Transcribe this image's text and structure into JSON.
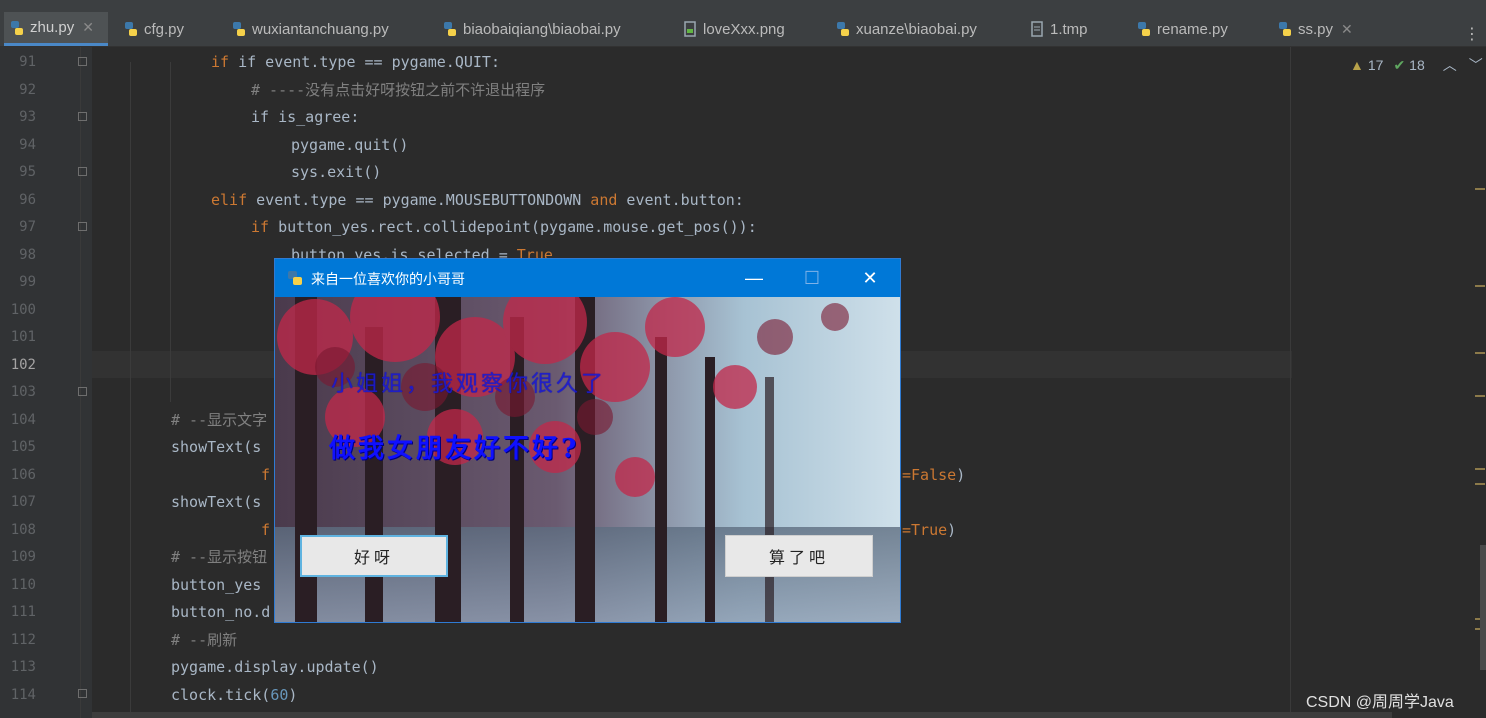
{
  "tabs": [
    {
      "label": "zhu.py",
      "active": true
    },
    {
      "label": "cfg.py"
    },
    {
      "label": "wuxiantanchuang.py"
    },
    {
      "label": "biaobaiqiang\\biaobai.py"
    },
    {
      "label": "loveXxx.png"
    },
    {
      "label": "xuanze\\biaobai.py"
    },
    {
      "label": "1.tmp"
    },
    {
      "label": "rename.py"
    },
    {
      "label": "ss.py"
    }
  ],
  "inspections": {
    "warnings": "17",
    "weak_warnings": "18"
  },
  "line_numbers": [
    "91",
    "92",
    "93",
    "94",
    "95",
    "96",
    "97",
    "98",
    "99",
    "100",
    "101",
    "102",
    "103",
    "104",
    "105",
    "106",
    "107",
    "108",
    "109",
    "110",
    "111",
    "112",
    "113",
    "114"
  ],
  "current_line": "102",
  "code": {
    "l91": "if event.type == pygame.QUIT:",
    "l92": "# ----没有点击好呀按钮之前不许退出程序",
    "l93": "if is_agree:",
    "l94": "pygame.quit()",
    "l95": "sys.exit()",
    "l96a": "elif",
    "l96b": " event.type == pygame.MOUSEBUTTONDOWN ",
    "l96c": "and",
    "l96d": " event.button:",
    "l97a": "if",
    "l97b": " button_yes.rect.collidepoint(pygame.mouse.get_pos()):",
    "l98a": "button_yes.is_selected = ",
    "l98b": "True",
    "l104": "# --显示文字",
    "l105": "showText(s",
    "l106a": "f",
    "l106b": "=False",
    "l106c": ")",
    "l107": "showText(s",
    "l108a": "f",
    "l108b": "=True",
    "l108c": ")",
    "l109": "# --显示按钮",
    "l110": "button_yes",
    "l111": "button_no.d",
    "l112": "# --刷新",
    "l113": "pygame.display.update()",
    "l114a": "clock.tick(",
    "l114b": "60",
    "l114c": ")"
  },
  "dialog": {
    "title": "来自一位喜欢你的小哥哥",
    "line1": "小姐姐，我观察你很久了",
    "line2": "做我女朋友好不好?",
    "yes_label": "好呀",
    "no_label": "算了吧"
  },
  "watermark": "CSDN @周周学Java",
  "colors": {
    "keyword": "#cc7832",
    "comment": "#808080",
    "number": "#6897bb",
    "text": "#a9b7c6",
    "titlebar": "#0078d7"
  }
}
